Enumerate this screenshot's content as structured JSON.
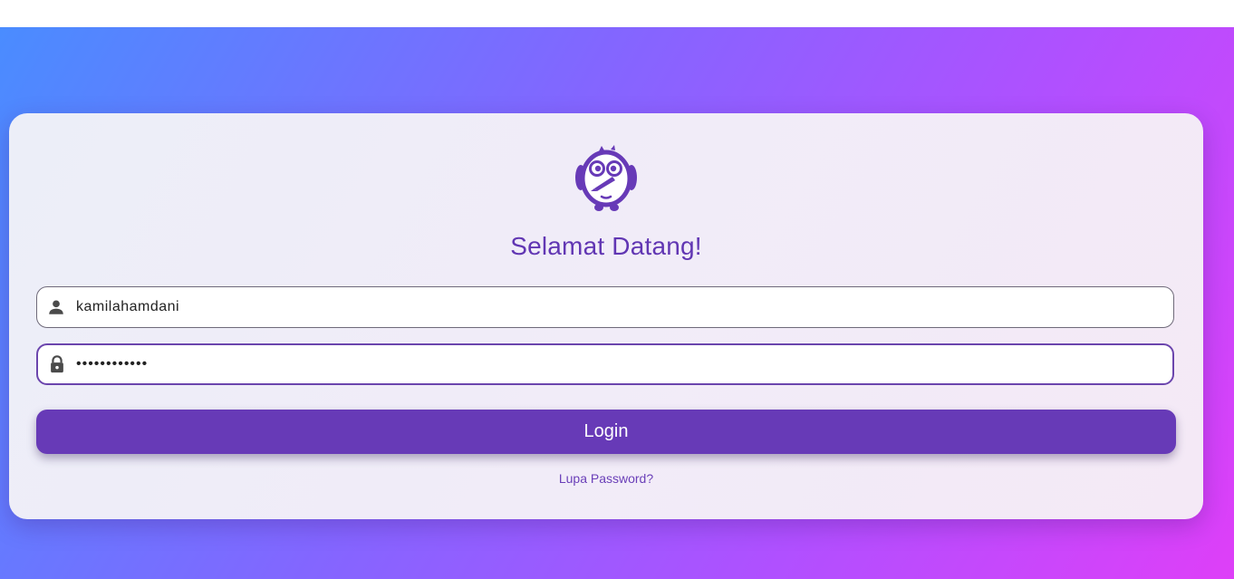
{
  "app": {
    "title": "Selamat Datang!",
    "logo_icon": "owl-logo-icon"
  },
  "form": {
    "username": {
      "value": "kamilahamdani",
      "icon": "person-icon"
    },
    "password": {
      "value": "••••••••••••",
      "icon": "lock-icon"
    },
    "login_label": "Login",
    "forgot_label": "Lupa Password?"
  },
  "colors": {
    "primary": "#673ab7",
    "title": "#6136b3",
    "gradient_start": "#4a8cff",
    "gradient_end": "#de3ff8"
  }
}
